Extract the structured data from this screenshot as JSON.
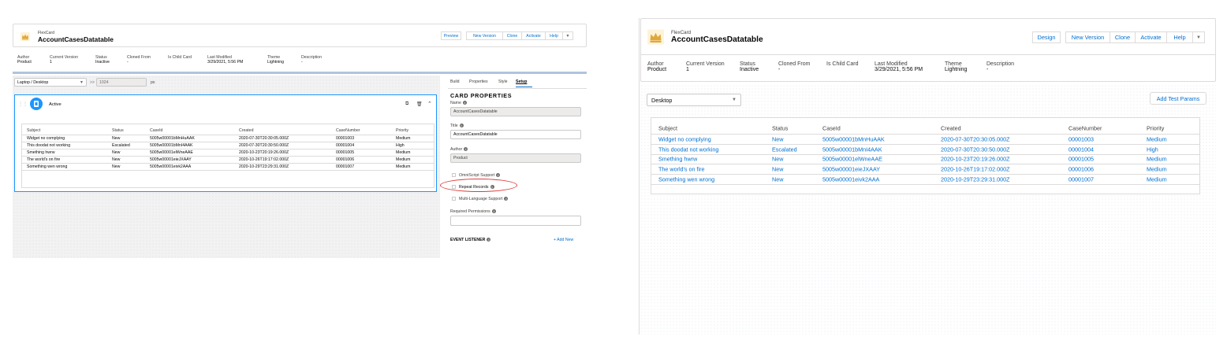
{
  "left": {
    "header": {
      "type_label": "FlexCard",
      "title": "AccountCasesDatatable",
      "buttons": [
        "Preview",
        "New Version",
        "Clone",
        "Activate",
        "Help"
      ],
      "menu_caret": "▼"
    },
    "meta": [
      {
        "label": "Author",
        "value": "Product"
      },
      {
        "label": "Current Version",
        "value": "1"
      },
      {
        "label": "Status",
        "value": "Inactive"
      },
      {
        "label": "Cloned From",
        "value": "-"
      },
      {
        "label": "Is Child Card",
        "value": ""
      },
      {
        "label": "Last Modified",
        "value": "3/29/2021, 5:56 PM"
      },
      {
        "label": "Theme",
        "value": "Lightning"
      },
      {
        "label": "Description",
        "value": "-"
      }
    ],
    "toolbar": {
      "device": "Laptop / Desktop",
      "arrows": ">>",
      "width_value": "1024",
      "unit": "px"
    },
    "card": {
      "state_label": "Active",
      "icons": [
        "copy-icon",
        "trash-icon",
        "chevron-up-icon"
      ]
    },
    "table": {
      "headers": [
        "Subject",
        "Status",
        "CaseId",
        "Created",
        "CaseNumber",
        "Priority"
      ],
      "rows": [
        [
          "Widget no complying",
          "New",
          "5005w00001bMnHuAAK",
          "2020-07-30T20:30:05.000Z",
          "00001003",
          "Medium"
        ],
        [
          "This doodat not working",
          "Escalated",
          "5005w00001bMnI4AAK",
          "2020-07-30T20:30:50.000Z",
          "00001004",
          "High"
        ],
        [
          "Smething hwrw",
          "New",
          "5005w00001elWneAAE",
          "2020-10-23T20:19:26.000Z",
          "00001005",
          "Medium"
        ],
        [
          "The world's on fire",
          "New",
          "5005w00001eieJXAAY",
          "2020-10-26T19:17:02.000Z",
          "00001006",
          "Medium"
        ],
        [
          "Something wen wrong",
          "New",
          "5005w00001eivk2AAA",
          "2020-10-29T23:29:31.000Z",
          "00001007",
          "Medium"
        ]
      ]
    },
    "right_panel": {
      "tabs": [
        "Build",
        "Properties",
        "Style",
        "Setup"
      ],
      "active_tab": "Setup",
      "section_title": "CARD PROPERTIES",
      "name_label": "Name",
      "name_value": "AccountCasesDatatable",
      "title_label": "Title",
      "title_value": "AccountCasesDatatable",
      "author_label": "Author",
      "author_value": "Product",
      "omniscript_label": "OmniScript Support",
      "repeat_label": "Repeat Records",
      "multilang_label": "Multi-Language Support",
      "permissions_label": "Required Permissions",
      "event_listener_label": "EVENT LISTENER",
      "add_new_label": "+ Add New"
    },
    "accent_colors": {
      "link": "#0070d2",
      "highlight_oval": "#e03b3b",
      "header_bar": "#b0c4df"
    }
  },
  "right": {
    "header": {
      "type_label": "FlexCard",
      "title": "AccountCasesDatatable",
      "buttons": [
        "Design",
        "New Version",
        "Clone",
        "Activate",
        "Help"
      ],
      "menu_caret": "▼"
    },
    "meta": [
      {
        "label": "Author",
        "value": "Product"
      },
      {
        "label": "Current Version",
        "value": "1"
      },
      {
        "label": "Status",
        "value": "Inactive"
      },
      {
        "label": "Cloned From",
        "value": "-"
      },
      {
        "label": "Is Child Card",
        "value": ""
      },
      {
        "label": "Last Modified",
        "value": "3/29/2021, 5:56 PM"
      },
      {
        "label": "Theme",
        "value": "Lightning"
      },
      {
        "label": "Description",
        "value": "-"
      }
    ],
    "toolbar": {
      "device": "Desktop",
      "add_test_params": "Add Test Params"
    },
    "table": {
      "headers": [
        "Subject",
        "Status",
        "CaseId",
        "Created",
        "CaseNumber",
        "Priority"
      ],
      "rows": [
        [
          "Widget no complying",
          "New",
          "5005w00001bMnHuAAK",
          "2020-07-30T20:30:05.000Z",
          "00001003",
          "Medium"
        ],
        [
          "This doodat not working",
          "Escalated",
          "5005w00001bMnI4AAK",
          "2020-07-30T20:30:50.000Z",
          "00001004",
          "High"
        ],
        [
          "Smething hwrw",
          "New",
          "5005w00001elWneAAE",
          "2020-10-23T20:19:26.000Z",
          "00001005",
          "Medium"
        ],
        [
          "The world's on fire",
          "New",
          "5005w00001eieJXAAY",
          "2020-10-26T19:17:02.000Z",
          "00001006",
          "Medium"
        ],
        [
          "Something wen wrong",
          "New",
          "5005w00001eivk2AAA",
          "2020-10-29T23:29:31.000Z",
          "00001007",
          "Medium"
        ]
      ]
    }
  }
}
